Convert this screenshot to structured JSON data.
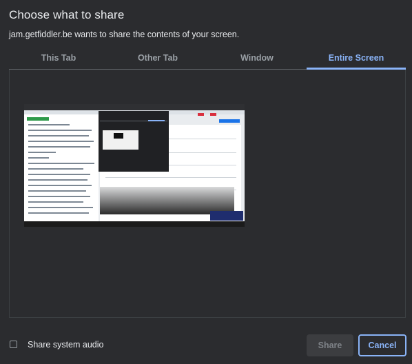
{
  "dialog": {
    "title": "Choose what to share",
    "subtitle": "jam.getfiddler.be wants to share the contents of your screen."
  },
  "tabs": [
    {
      "label": "This Tab",
      "active": false
    },
    {
      "label": "Other Tab",
      "active": false
    },
    {
      "label": "Window",
      "active": false
    },
    {
      "label": "Entire Screen",
      "active": true
    }
  ],
  "preview": {
    "icon": "screen-thumbnail"
  },
  "footer": {
    "audio_label": "Share system audio",
    "audio_checked": false,
    "share_label": "Share",
    "cancel_label": "Cancel"
  },
  "colors": {
    "background": "#2b2c2f",
    "accent": "#8ab4f8",
    "text": "#e8eaed",
    "muted": "#9aa0a6"
  }
}
